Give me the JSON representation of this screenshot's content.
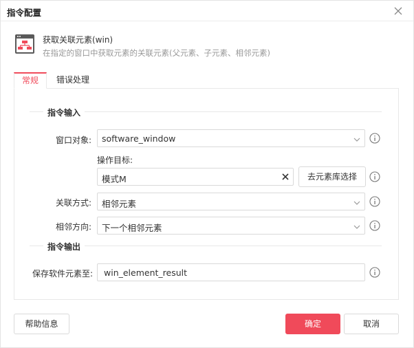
{
  "dialog": {
    "title": "指令配置",
    "close_icon": "close-icon"
  },
  "header": {
    "icon": "element-tree-icon",
    "title": "获取关联元素(win)",
    "description": "在指定的窗口中获取元素的关联元素(父元素、子元素、相邻元素)"
  },
  "tabs": [
    {
      "label": "常规",
      "active": true
    },
    {
      "label": "错误处理",
      "active": false
    }
  ],
  "sections": {
    "input_title": "指令输入",
    "output_title": "指令输出"
  },
  "fields": {
    "window_object": {
      "label": "窗口对象:",
      "value": "software_window"
    },
    "target": {
      "label": "操作目标:",
      "value": "模式M",
      "library_button": "去元素库选择"
    },
    "relation_mode": {
      "label": "关联方式:",
      "value": "相邻元素"
    },
    "sibling_direction": {
      "label": "相邻方向:",
      "value": "下一个相邻元素"
    },
    "save_to": {
      "label": "保存软件元素至:",
      "value": "win_element_result"
    }
  },
  "footer": {
    "help": "帮助信息",
    "ok": "确定",
    "cancel": "取消"
  },
  "colors": {
    "accent": "#f04a5a",
    "border": "#d9d9d9",
    "muted_text": "#999999"
  }
}
